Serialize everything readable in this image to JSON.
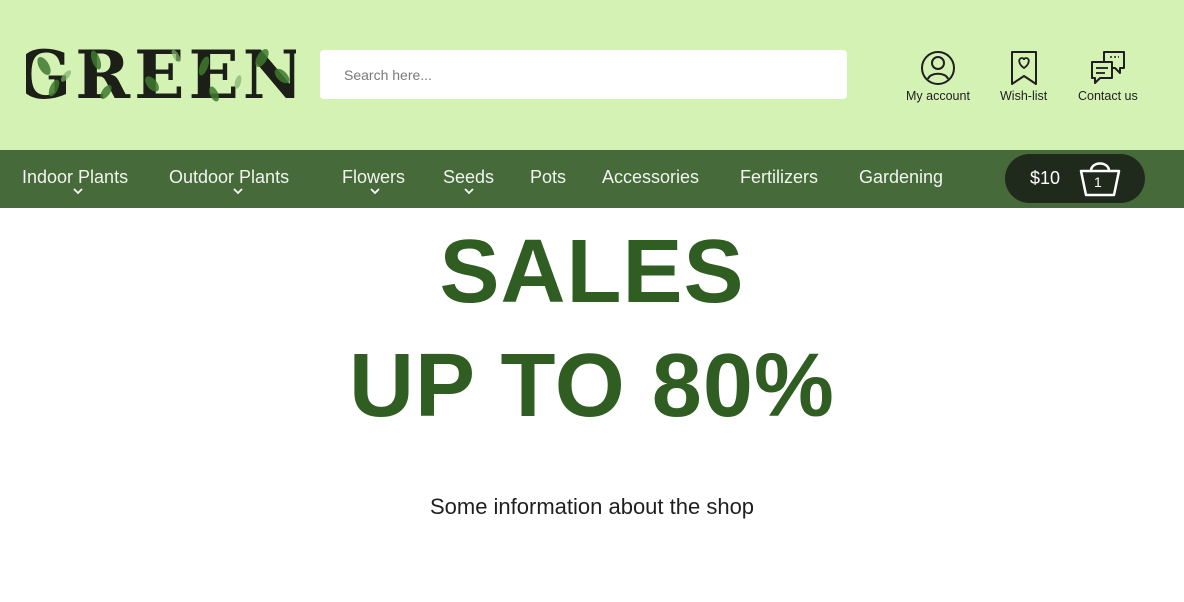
{
  "header": {
    "logo_text": "GREEN",
    "search": {
      "placeholder": "Search here...",
      "value": ""
    },
    "actions": [
      {
        "label": "My account",
        "icon": "user-icon"
      },
      {
        "label": "Wish-list",
        "icon": "bookmark-heart-icon"
      },
      {
        "label": "Contact us",
        "icon": "chat-icon"
      }
    ]
  },
  "nav": {
    "items": [
      {
        "label": "Indoor Plants",
        "has_dropdown": true
      },
      {
        "label": "Outdoor Plants",
        "has_dropdown": true
      },
      {
        "label": "Flowers",
        "has_dropdown": true
      },
      {
        "label": "Seeds",
        "has_dropdown": true
      },
      {
        "label": "Pots",
        "has_dropdown": false
      },
      {
        "label": "Accessories",
        "has_dropdown": false
      },
      {
        "label": "Fertilizers",
        "has_dropdown": false
      },
      {
        "label": "Gardening",
        "has_dropdown": false
      }
    ],
    "cart": {
      "total": "$10",
      "count": "1",
      "icon": "basket-icon"
    }
  },
  "hero": {
    "line1": "SALES",
    "line2": "UP TO 80%",
    "info": "Some information about the shop"
  },
  "colors": {
    "header_bg": "#d5f2b5",
    "nav_bg": "#466a39",
    "cart_bg": "#1f2a1c",
    "accent_green": "#2f5d22"
  }
}
